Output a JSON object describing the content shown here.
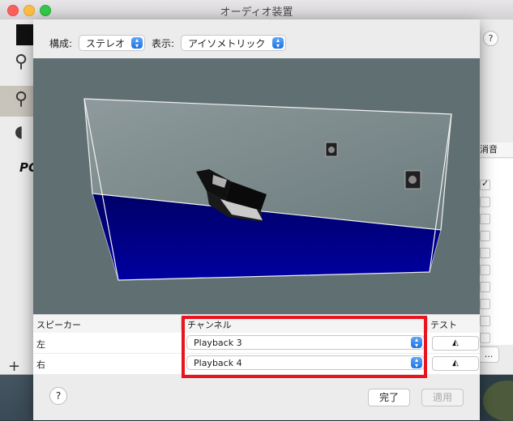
{
  "window": {
    "title": "オーディオ装置"
  },
  "main_window": {
    "help_label": "?",
    "logo_text": "PC",
    "mute_header": "消音",
    "mute_checks": [
      true,
      false,
      false,
      false,
      false,
      false,
      false,
      false,
      false,
      false
    ],
    "dots_button": "...",
    "add_button": "+"
  },
  "sheet": {
    "config_label": "構成:",
    "config_value": "ステレオ",
    "view_label": "表示:",
    "view_value": "アイソメトリック",
    "table": {
      "headers": {
        "speaker": "スピーカー",
        "channel": "チャンネル",
        "test": "テスト"
      },
      "rows": [
        {
          "speaker": "左",
          "channel": "Playback 3"
        },
        {
          "speaker": "右",
          "channel": "Playback 4"
        }
      ]
    },
    "help_label": "?",
    "done_button": "完了",
    "apply_button": "適用"
  },
  "colors": {
    "highlight": "#e8141f",
    "floor": "#00008c",
    "scene_background": "#607072",
    "accent": "#1f73e0"
  }
}
